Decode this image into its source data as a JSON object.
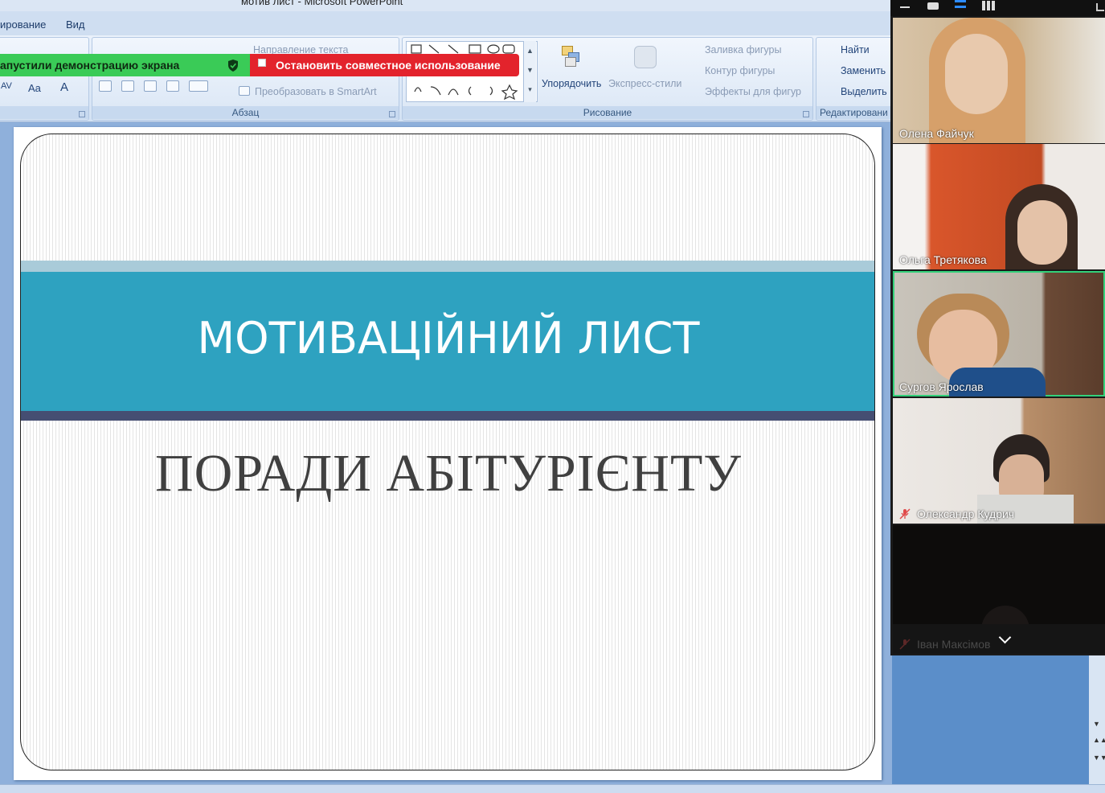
{
  "window": {
    "title": "мотив лист - Microsoft PowerPoint"
  },
  "tabs": [
    {
      "label": "ирование"
    },
    {
      "label": "Вид"
    }
  ],
  "ribbon": {
    "paragraph": {
      "label": "Абзац",
      "text_direction": "Направление текста",
      "convert_smartart": "Преобразовать в SmartArt"
    },
    "drawing": {
      "label": "Рисование",
      "arrange": "Упорядочить",
      "quick_styles": "Экспресс-стили",
      "shape_fill": "Заливка фигуры",
      "shape_outline": "Контур фигуры",
      "shape_effects": "Эффекты для фигур"
    },
    "editing": {
      "label": "Редактировани",
      "find": "Найти",
      "replace": "Заменить",
      "select": "Выделить"
    },
    "font_small": {
      "spacing": "AV",
      "case": "Aa",
      "color": "A"
    }
  },
  "share_bar": {
    "status": "апустили демонстрацию экрана",
    "stop_label": "Остановить совместное использование",
    "status_color": "#3acb57",
    "stop_color": "#e3232c"
  },
  "slide": {
    "title": "МОТИВАЦІЙНИЙ ЛИСТ",
    "subtitle": "ПОРАДИ АБІТУРІЄНТУ"
  },
  "participants": [
    {
      "name": "Олена Файчук",
      "muted": false,
      "active": false
    },
    {
      "name": "Ольга Третякова",
      "muted": false,
      "active": false
    },
    {
      "name": "Сургов Ярослав",
      "muted": false,
      "active": true
    },
    {
      "name": "Олександр Кудрич",
      "muted": true,
      "active": false
    },
    {
      "name": "Іван Максімов",
      "muted": true,
      "active": false
    }
  ],
  "zoom_controls": {
    "more_icon": "chevron-down-icon"
  }
}
